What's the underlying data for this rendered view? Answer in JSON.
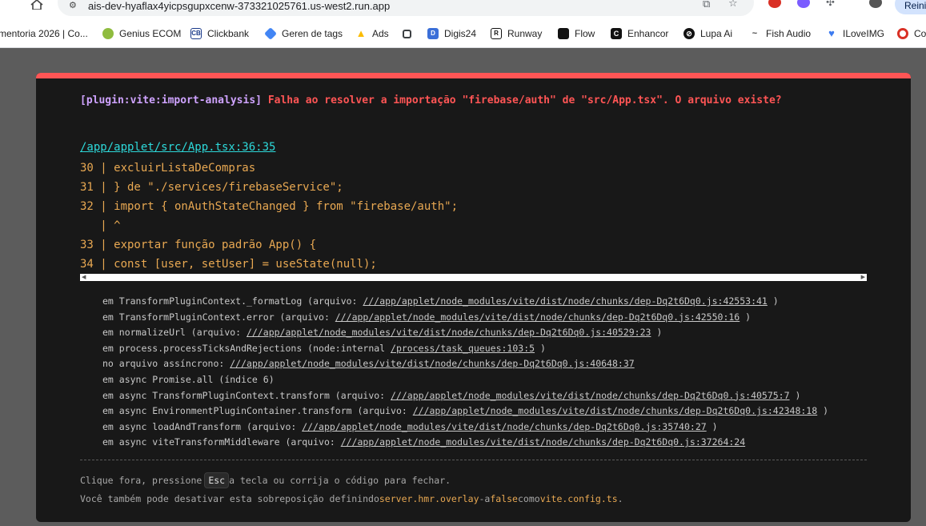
{
  "browser": {
    "url": "ais-dev-hyaflax4yicpsgupxcenw-373321025761.us-west2.run.app",
    "reload_label": "Reinic"
  },
  "bookmarks": [
    {
      "label": "mentoria 2026 | Co...",
      "icon": "page-icon",
      "color": "#5f6368"
    },
    {
      "label": "Genius ECOM",
      "icon": "genius-icon",
      "color": "#6b8e23"
    },
    {
      "label": "Clickbank",
      "icon": "clickbank-icon",
      "color": "#1a3a8a"
    },
    {
      "label": "Geren de tags",
      "icon": "tag-manager-icon",
      "color": "#4285f4"
    },
    {
      "label": "Ads",
      "icon": "google-ads-icon",
      "color": "#fbbc04"
    },
    {
      "label": "",
      "icon": "extension-icon",
      "color": "#3c4043"
    },
    {
      "label": "Digis24",
      "icon": "digis-icon",
      "color": "#3b6fd8"
    },
    {
      "label": "Runway",
      "icon": "runway-icon",
      "color": "#111111"
    },
    {
      "label": "Flow",
      "icon": "flow-icon",
      "color": "#111111"
    },
    {
      "label": "Enhancor",
      "icon": "enhancor-icon",
      "color": "#111111"
    },
    {
      "label": "Lupa Ai",
      "icon": "lupa-icon",
      "color": "#111111"
    },
    {
      "label": "Fish Audio",
      "icon": "fish-icon",
      "color": "#444444"
    },
    {
      "label": "ILoveIMG",
      "icon": "heart-icon",
      "color": "#3c7bf0"
    },
    {
      "label": "Co",
      "icon": "circle-icon",
      "color": "#d93025"
    }
  ],
  "overlay": {
    "plugin": "[plugin:vite:import-analysis]",
    "message": "Falha ao resolver a importação \"firebase/auth\" de \"src/App.tsx\". O arquivo existe?",
    "file": "/app/applet/src/App.tsx:36:35",
    "frame": [
      "30 | excluirListaDeCompras",
      "31 | } de \"./services/firebaseService\";",
      "32 | import { onAuthStateChanged } from \"firebase/auth\";",
      "   | ^",
      "33 | exportar função padrão App() {",
      "34 | const [user, setUser] = useState(null);"
    ],
    "stack": [
      {
        "pre": "em TransformPluginContext._formatLog (arquivo: ",
        "link": "///app/applet/node_modules/vite/dist/node/chunks/dep-Dq2t6Dq0.js:42553:41",
        "post": " )"
      },
      {
        "pre": "em TransformPluginContext.error (arquivo: ",
        "link": "///app/applet/node_modules/vite/dist/node/chunks/dep-Dq2t6Dq0.js:42550:16",
        "post": " )"
      },
      {
        "pre": "em normalizeUrl (arquivo: ",
        "link": "///app/applet/node_modules/vite/dist/node/chunks/dep-Dq2t6Dq0.js:40529:23",
        "post": " )"
      },
      {
        "pre": "em process.processTicksAndRejections (node:internal ",
        "link": "/process/task_queues:103:5",
        "post": " )"
      },
      {
        "pre": "no arquivo assíncrono: ",
        "link": "///app/applet/node_modules/vite/dist/node/chunks/dep-Dq2t6Dq0.js:40648:37",
        "post": ""
      },
      {
        "pre": "em async Promise.all (índice 6)",
        "link": "",
        "post": ""
      },
      {
        "pre": "em async TransformPluginContext.transform (arquivo: ",
        "link": "///app/applet/node_modules/vite/dist/node/chunks/dep-Dq2t6Dq0.js:40575:7",
        "post": " )"
      },
      {
        "pre": "em async EnvironmentPluginContainer.transform (arquivo: ",
        "link": "///app/applet/node_modules/vite/dist/node/chunks/dep-Dq2t6Dq0.js:42348:18",
        "post": " )"
      },
      {
        "pre": "em async loadAndTransform (arquivo: ",
        "link": "///app/applet/node_modules/vite/dist/node/chunks/dep-Dq2t6Dq0.js:35740:27",
        "post": " )"
      },
      {
        "pre": "em async viteTransformMiddleware (arquivo: ",
        "link": "///app/applet/node_modules/vite/dist/node/chunks/dep-Dq2t6Dq0.js:37264:24",
        "post": ""
      }
    ],
    "tip1_pre": "Clique fora, pressione ",
    "tip1_key": "Esc",
    "tip1_post": "a tecla ou corrija o código para fechar.",
    "tip2_pre": "Você também pode desativar esta sobreposição definindo ",
    "tip2_code1": "server.hmr.overlay",
    "tip2_mid1": "-a ",
    "tip2_code2": "false",
    "tip2_mid2": "como ",
    "tip2_code3": "vite.config.ts",
    "tip2_end": ".",
    "accent": "#ff5555"
  }
}
